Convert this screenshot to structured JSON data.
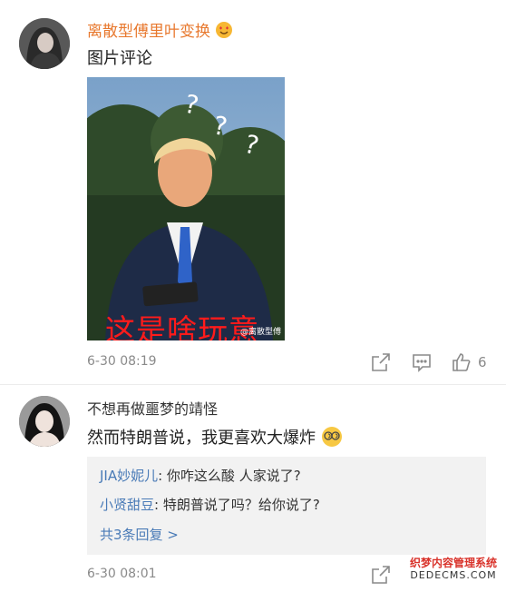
{
  "comment1": {
    "username": "离散型傅里叶变换",
    "text": "图片评论",
    "meme_caption": "这是啥玩意",
    "watermark": "@离散型傅",
    "timestamp": "6-30 08:19",
    "like_count": "6"
  },
  "comment2": {
    "username": "不想再做噩梦的靖怪",
    "text": "然而特朗普说，我更喜欢大爆炸",
    "replies": [
      {
        "name": "JIA妙妮儿",
        "text": ": 你咋这么酸 人家说了?"
      },
      {
        "name": "小贤甜豆",
        "text": ": 特朗普说了吗？给你说了?"
      }
    ],
    "more_label": "共3条回复 >",
    "timestamp": "6-30 08:01"
  },
  "site_watermark": {
    "line1": "织梦内容管理系统",
    "line2": "DEDECMS.COM"
  },
  "colors": {
    "username_orange": "#e8792f",
    "link_blue": "#4a7bb7"
  }
}
